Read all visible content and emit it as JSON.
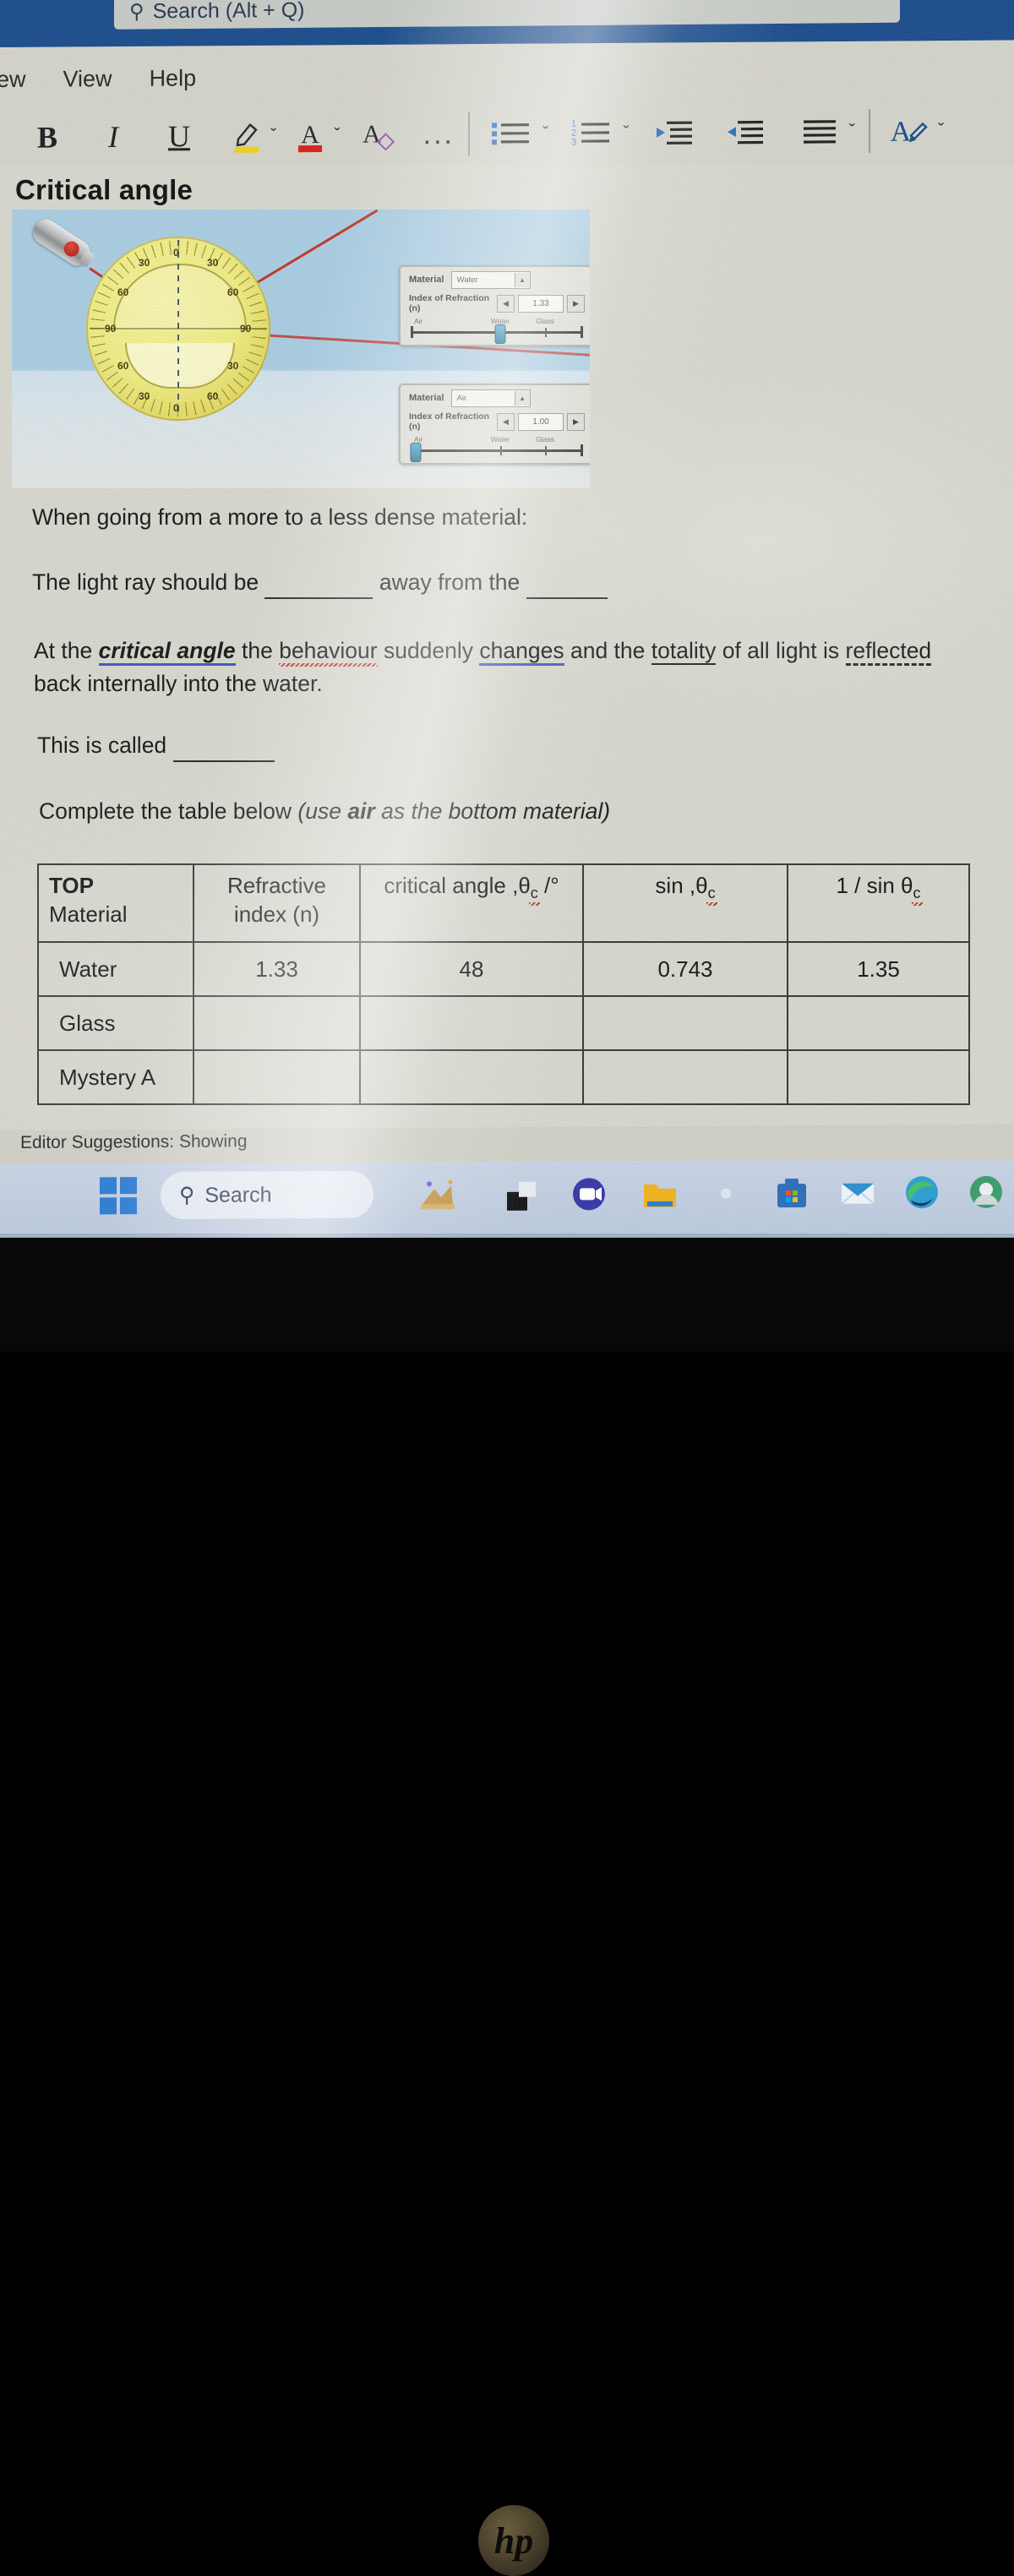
{
  "app": {
    "search_placeholder": "Search (Alt + Q)",
    "menu": [
      "iew",
      "View",
      "Help"
    ]
  },
  "toolbar": {
    "bold": "B",
    "italic": "I",
    "underline": "U",
    "highlight_label": "text-highlight",
    "font_color_label": "font-color",
    "clear_format_label": "clear-formatting",
    "more_label": "...",
    "bullets_label": "bullet-list",
    "numbering_label": "numbered-list",
    "decrease_indent_label": "decrease-indent",
    "increase_indent_label": "increase-indent",
    "align_label": "alignment",
    "styles_label": "styles",
    "chevron": "ˇ",
    "numbers": [
      "1",
      "2",
      "3"
    ],
    "highlight_color": "#f2cf1b",
    "font_color": "#d8231c",
    "accent_blue": "#2f6fba"
  },
  "document": {
    "title": "Critical angle",
    "line1": "When going from a more to a less dense material:",
    "line2_a": "The light ray should be",
    "line2_b": "away from the",
    "para_a": "At the ",
    "para_critical": "critical angle",
    "para_b": " the ",
    "para_behaviour": "behaviour",
    "para_c": " suddenly ",
    "para_changes": "changes",
    "para_d": " and the ",
    "para_totality": "totality",
    "para_e": " of all light is ",
    "para_reflected": "reflected",
    "para_f": "back internally into the water.",
    "line3": "This is called",
    "line4_a": "Complete the table below ",
    "line4_italic_a": "(use ",
    "line4_bold": "air",
    "line4_italic_b": " as the bottom material)"
  },
  "simulation": {
    "panel_top": {
      "material_label": "Material",
      "material_value": "Water",
      "index_label": "Index of Refraction (n)",
      "index_value": "1.33",
      "slider_labels": [
        "Air",
        "Water",
        "Glass"
      ],
      "knob_percent": 52
    },
    "panel_bottom": {
      "material_label": "Material",
      "material_value": "Air",
      "index_label": "Index of Refraction (n)",
      "index_value": "1.00",
      "slider_labels": [
        "Air",
        "Water",
        "Glass"
      ],
      "knob_percent": 3
    },
    "protractor_numbers": [
      "30",
      "60",
      "90",
      "90",
      "60",
      "30",
      "0",
      "0",
      "30",
      "60",
      "60",
      "30"
    ],
    "device": "laser-pointer",
    "ray_color": "#c0392b",
    "sky_color": "#a9cbe0"
  },
  "table": {
    "headers": [
      {
        "bold": "TOP",
        "rest": "Material"
      },
      {
        "line1": "Refractive",
        "line2": "index (n)"
      },
      {
        "text": "critical angle ,θ",
        "sub": "c",
        "suffix": " /°"
      },
      {
        "text": "sin ,θ",
        "sub": "c",
        "suffix": ""
      },
      {
        "text": "1 / sin θ",
        "sub": "c",
        "suffix": ""
      }
    ],
    "rows": [
      {
        "material": "Water",
        "index": "1.33",
        "critical_angle": "48",
        "sin": "0.743",
        "inv_sin": "1.35"
      },
      {
        "material": "Glass",
        "index": "",
        "critical_angle": "",
        "sin": "",
        "inv_sin": ""
      },
      {
        "material": "Mystery A",
        "index": "",
        "critical_angle": "",
        "sin": "",
        "inv_sin": ""
      }
    ]
  },
  "status": {
    "editor_suggestions": "Editor Suggestions: Showing"
  },
  "taskbar": {
    "search_label": "Search",
    "icons": [
      "copilot-icon",
      "teams-icon",
      "file-explorer-icon",
      "microsoft365-icon",
      "store-icon",
      "mail-icon",
      "edge-icon",
      "app-icon"
    ]
  },
  "hardware": {
    "brand": "hp"
  }
}
